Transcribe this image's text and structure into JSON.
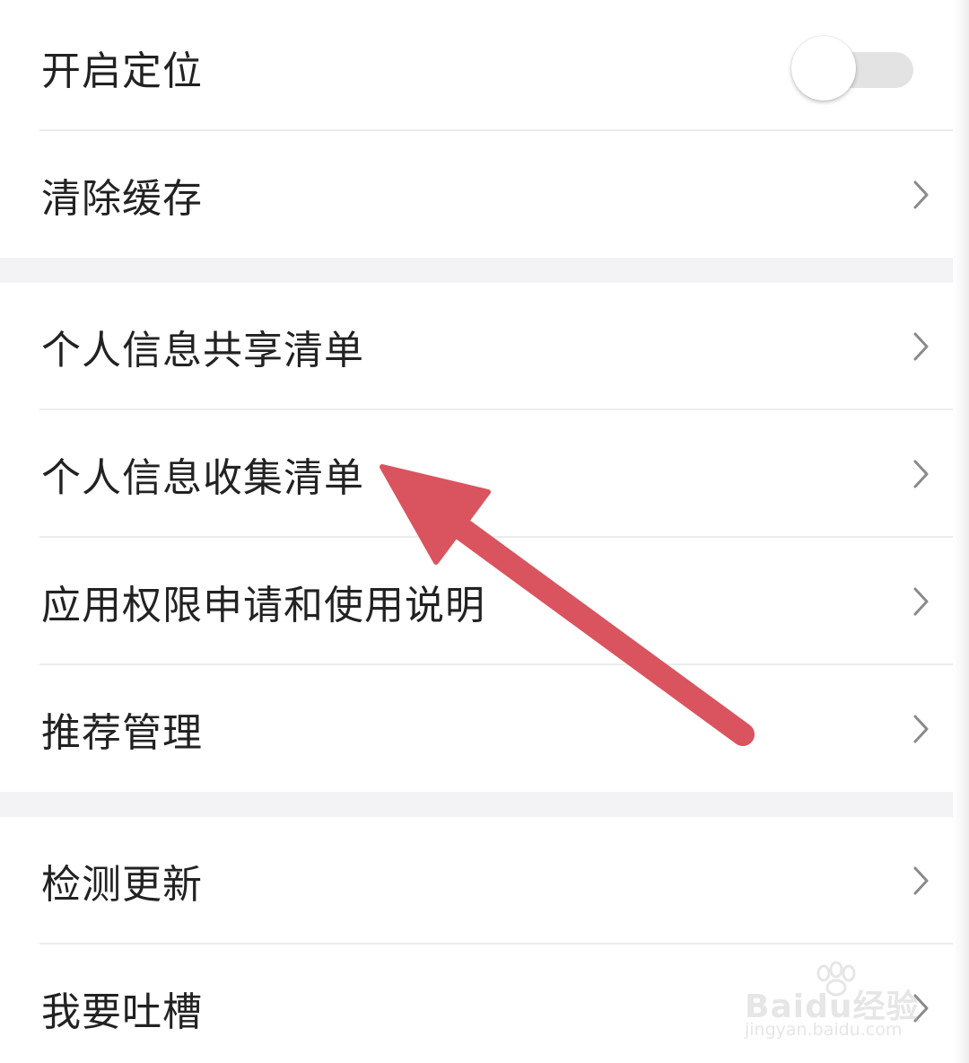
{
  "settings": {
    "location": {
      "label": "开启定位",
      "enabled": false
    },
    "clear_cache": {
      "label": "清除缓存"
    },
    "items_group2": [
      {
        "label": "个人信息共享清单"
      },
      {
        "label": "个人信息收集清单"
      },
      {
        "label": "应用权限申请和使用说明"
      },
      {
        "label": "推荐管理"
      }
    ],
    "items_group3": [
      {
        "label": "检测更新"
      },
      {
        "label": "我要吐槽"
      }
    ]
  },
  "colors": {
    "annotation_arrow": "#d9545e",
    "text": "#222222",
    "chevron": "#8a8a8a",
    "toggle_track": "#e3e3e3",
    "section_gap": "#f3f3f5"
  },
  "icons": {
    "chevron": "chevron-right-icon",
    "annotation": "red-arrow-pointer"
  },
  "watermark": {
    "brand": "Baidu经验",
    "url": "jingyan.baidu.com"
  }
}
